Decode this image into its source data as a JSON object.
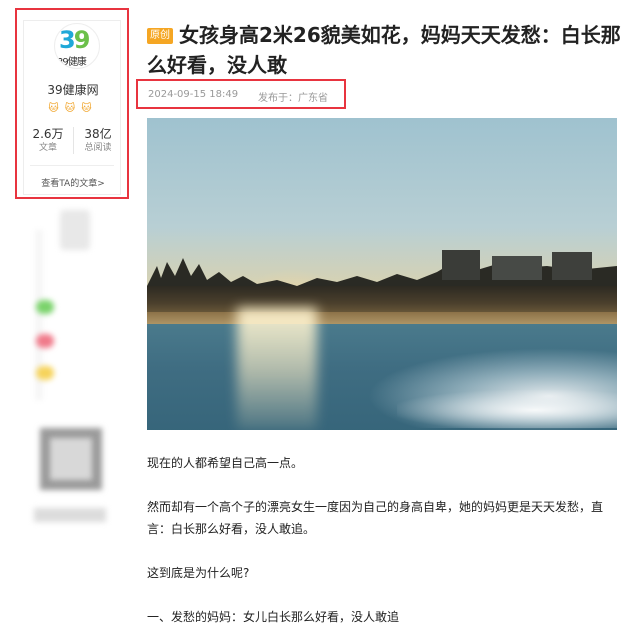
{
  "author": {
    "name": "39健康网",
    "avatar_text_main": "39",
    "avatar_text_sub": "39健康",
    "badges": "🐱🐱🐱",
    "stats": [
      {
        "value": "2.6万",
        "label": "文章"
      },
      {
        "value": "38亿",
        "label": "总阅读"
      }
    ],
    "view_articles": "查看TA的文章>"
  },
  "article": {
    "tag": "原创",
    "title": "女孩身高2米26貌美如花，妈妈天天发愁：白长那么好看，没人敢",
    "date": "2024-09-15 18:49",
    "location": "发布于：广东省",
    "paragraphs": [
      "现在的人都希望自己高一点。",
      "然而却有一个高个子的漂亮女生一度因为自己的身高自卑，她的妈妈更是天天发愁，直言：白长那么好看，没人敢追。",
      "这到底是为什么呢?",
      "一、发愁的妈妈：女儿白长那么好看，没人敢追"
    ]
  },
  "colors": {
    "highlight_box": "#e8343f",
    "original_tag": "#f5a623"
  },
  "icons": [
    "avatar-logo",
    "badge-icons",
    "hero-photo"
  ]
}
